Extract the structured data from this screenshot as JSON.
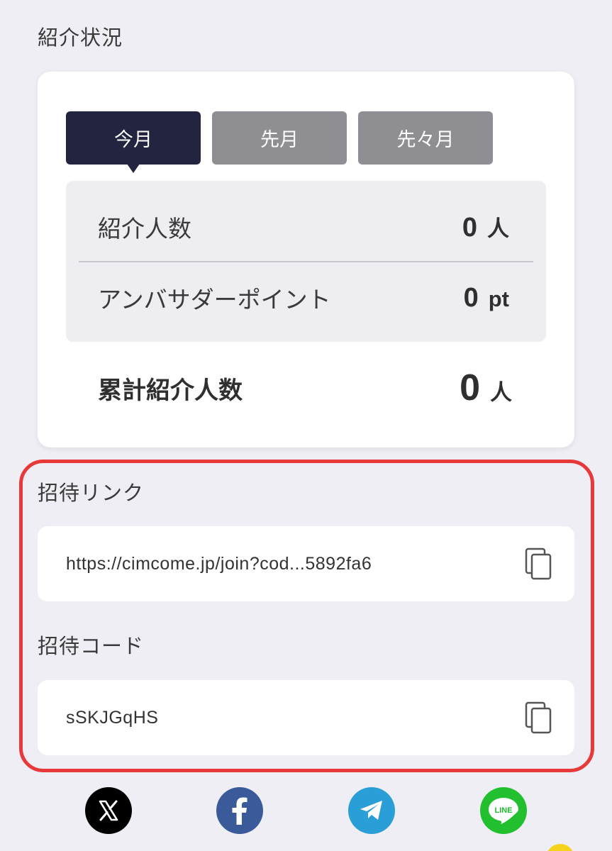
{
  "status_section": {
    "title": "紹介状況",
    "tabs": [
      {
        "label": "今月",
        "active": true
      },
      {
        "label": "先月",
        "active": false
      },
      {
        "label": "先々月",
        "active": false
      }
    ],
    "referrals": {
      "label": "紹介人数",
      "value": "0",
      "unit": "人"
    },
    "ambassador_points": {
      "label": "アンバサダーポイント",
      "value": "0",
      "unit": "pt"
    },
    "total_referrals": {
      "label": "累計紹介人数",
      "value": "0",
      "unit": "人"
    }
  },
  "invite_link": {
    "title": "招待リンク",
    "value": "https://cimcome.jp/join?cod...5892fa6",
    "copy_icon": "copy-icon"
  },
  "invite_code": {
    "title": "招待コード",
    "value": "sSKJGqHS",
    "copy_icon": "copy-icon"
  },
  "share": {
    "icons": [
      "x-icon",
      "facebook-icon",
      "telegram-icon",
      "line-icon"
    ],
    "line_label": "LINE"
  },
  "colors": {
    "background": "#efeef4",
    "active_tab": "#23243f",
    "inactive_tab": "#8e8e93",
    "highlight": "#e8393a",
    "x": "#000000",
    "facebook": "#3b5a9a",
    "telegram": "#2a9ed6",
    "line": "#22bf2e"
  }
}
